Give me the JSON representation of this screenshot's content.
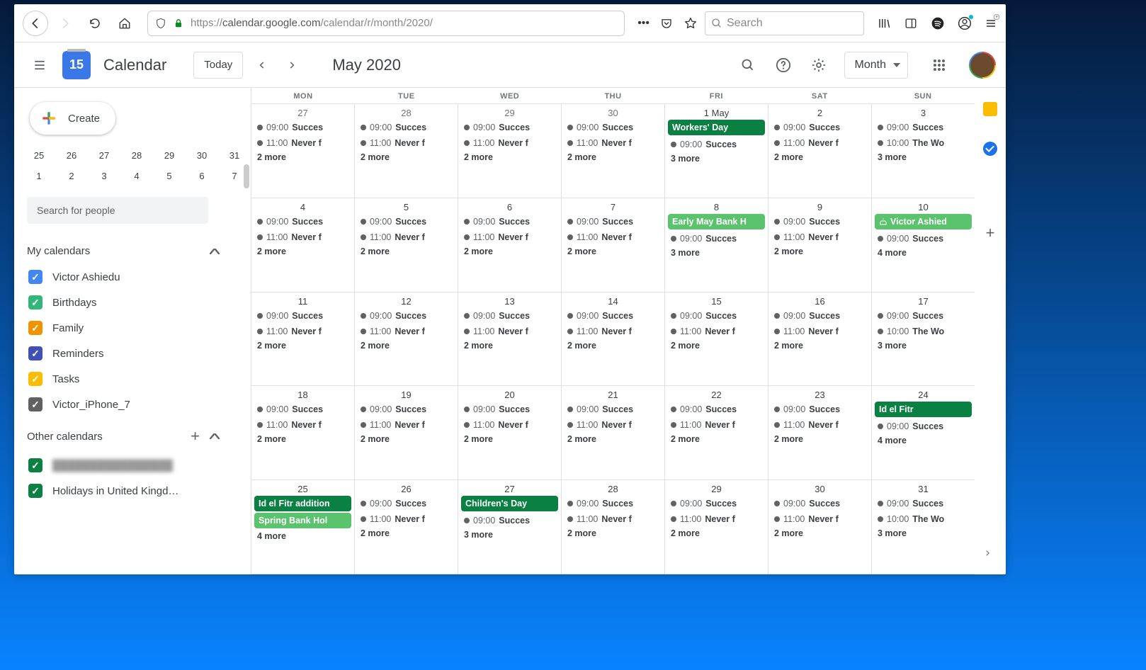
{
  "chrome": {
    "url_prefix": "https://",
    "url_host": "calendar.google.com",
    "url_path": "/calendar/r/month/2020/",
    "search_placeholder": "Search"
  },
  "header": {
    "logo_num": "15",
    "title": "Calendar",
    "today_label": "Today",
    "month_title": "May 2020",
    "view_label": "Month"
  },
  "sidebar": {
    "create_label": "Create",
    "mini_row1": [
      "25",
      "26",
      "27",
      "28",
      "29",
      "30",
      "31"
    ],
    "mini_row2": [
      "1",
      "2",
      "3",
      "4",
      "5",
      "6",
      "7"
    ],
    "search_placeholder": "Search for people",
    "section1_title": "My calendars",
    "calendars": [
      {
        "label": "Victor Ashiedu",
        "color": "#4285f4"
      },
      {
        "label": "Birthdays",
        "color": "#33b679"
      },
      {
        "label": "Family",
        "color": "#f09300"
      },
      {
        "label": "Reminders",
        "color": "#3f51b5"
      },
      {
        "label": "Tasks",
        "color": "#fbbc04"
      },
      {
        "label": "Victor_iPhone_7",
        "color": "#616161"
      }
    ],
    "section2_title": "Other calendars",
    "other_calendars": [
      {
        "label": "████████████████",
        "color": "#0b8043",
        "blur": true
      },
      {
        "label": "Holidays in United Kingd…",
        "color": "#0b8043"
      }
    ]
  },
  "dow": [
    "MON",
    "TUE",
    "WED",
    "THU",
    "FRI",
    "SAT",
    "SUN"
  ],
  "weeks": [
    {
      "days": [
        {
          "num": "27",
          "cur": false,
          "alldays": [],
          "events": [
            [
              "09:00",
              "Succes"
            ],
            [
              "11:00",
              "Never f"
            ]
          ],
          "more": "2 more"
        },
        {
          "num": "28",
          "cur": false,
          "alldays": [],
          "events": [
            [
              "09:00",
              "Succes"
            ],
            [
              "11:00",
              "Never f"
            ]
          ],
          "more": "2 more"
        },
        {
          "num": "29",
          "cur": false,
          "alldays": [],
          "events": [
            [
              "09:00",
              "Succes"
            ],
            [
              "11:00",
              "Never f"
            ]
          ],
          "more": "2 more"
        },
        {
          "num": "30",
          "cur": false,
          "alldays": [],
          "events": [
            [
              "09:00",
              "Succes"
            ],
            [
              "11:00",
              "Never f"
            ]
          ],
          "more": "2 more"
        },
        {
          "num": "1 May",
          "cur": true,
          "alldays": [
            {
              "text": "Workers' Day",
              "style": "dark"
            }
          ],
          "events": [
            [
              "09:00",
              "Succes"
            ]
          ],
          "more": "3 more"
        },
        {
          "num": "2",
          "cur": true,
          "alldays": [],
          "events": [
            [
              "09:00",
              "Succes"
            ],
            [
              "11:00",
              "Never f"
            ]
          ],
          "more": "2 more"
        },
        {
          "num": "3",
          "cur": true,
          "alldays": [],
          "events": [
            [
              "09:00",
              "Succes"
            ],
            [
              "10:00",
              "The Wo"
            ]
          ],
          "more": "3 more"
        }
      ]
    },
    {
      "days": [
        {
          "num": "4",
          "cur": true,
          "alldays": [],
          "events": [
            [
              "09:00",
              "Succes"
            ],
            [
              "11:00",
              "Never f"
            ]
          ],
          "more": "2 more"
        },
        {
          "num": "5",
          "cur": true,
          "alldays": [],
          "events": [
            [
              "09:00",
              "Succes"
            ],
            [
              "11:00",
              "Never f"
            ]
          ],
          "more": "2 more"
        },
        {
          "num": "6",
          "cur": true,
          "alldays": [],
          "events": [
            [
              "09:00",
              "Succes"
            ],
            [
              "11:00",
              "Never f"
            ]
          ],
          "more": "2 more"
        },
        {
          "num": "7",
          "cur": true,
          "alldays": [],
          "events": [
            [
              "09:00",
              "Succes"
            ],
            [
              "11:00",
              "Never f"
            ]
          ],
          "more": "2 more"
        },
        {
          "num": "8",
          "cur": true,
          "alldays": [
            {
              "text": "Early May Bank H",
              "style": "light"
            }
          ],
          "events": [
            [
              "09:00",
              "Succes"
            ]
          ],
          "more": "3 more"
        },
        {
          "num": "9",
          "cur": true,
          "alldays": [],
          "events": [
            [
              "09:00",
              "Succes"
            ],
            [
              "11:00",
              "Never f"
            ]
          ],
          "more": "2 more"
        },
        {
          "num": "10",
          "cur": true,
          "alldays": [
            {
              "text": "Victor Ashied",
              "style": "light",
              "icon": "birthday"
            }
          ],
          "events": [
            [
              "09:00",
              "Succes"
            ]
          ],
          "more": "4 more",
          "highlight": true
        }
      ]
    },
    {
      "days": [
        {
          "num": "11",
          "cur": true,
          "alldays": [],
          "events": [
            [
              "09:00",
              "Succes"
            ],
            [
              "11:00",
              "Never f"
            ]
          ],
          "more": "2 more"
        },
        {
          "num": "12",
          "cur": true,
          "alldays": [],
          "events": [
            [
              "09:00",
              "Succes"
            ],
            [
              "11:00",
              "Never f"
            ]
          ],
          "more": "2 more"
        },
        {
          "num": "13",
          "cur": true,
          "alldays": [],
          "events": [
            [
              "09:00",
              "Succes"
            ],
            [
              "11:00",
              "Never f"
            ]
          ],
          "more": "2 more"
        },
        {
          "num": "14",
          "cur": true,
          "alldays": [],
          "events": [
            [
              "09:00",
              "Succes"
            ],
            [
              "11:00",
              "Never f"
            ]
          ],
          "more": "2 more"
        },
        {
          "num": "15",
          "cur": true,
          "alldays": [],
          "events": [
            [
              "09:00",
              "Succes"
            ],
            [
              "11:00",
              "Never f"
            ]
          ],
          "more": "2 more"
        },
        {
          "num": "16",
          "cur": true,
          "alldays": [],
          "events": [
            [
              "09:00",
              "Succes"
            ],
            [
              "11:00",
              "Never f"
            ]
          ],
          "more": "2 more"
        },
        {
          "num": "17",
          "cur": true,
          "alldays": [],
          "events": [
            [
              "09:00",
              "Succes"
            ],
            [
              "10:00",
              "The Wo"
            ]
          ],
          "more": "3 more"
        }
      ]
    },
    {
      "days": [
        {
          "num": "18",
          "cur": true,
          "alldays": [],
          "events": [
            [
              "09:00",
              "Succes"
            ],
            [
              "11:00",
              "Never f"
            ]
          ],
          "more": "2 more"
        },
        {
          "num": "19",
          "cur": true,
          "alldays": [],
          "events": [
            [
              "09:00",
              "Succes"
            ],
            [
              "11:00",
              "Never f"
            ]
          ],
          "more": "2 more"
        },
        {
          "num": "20",
          "cur": true,
          "alldays": [],
          "events": [
            [
              "09:00",
              "Succes"
            ],
            [
              "11:00",
              "Never f"
            ]
          ],
          "more": "2 more"
        },
        {
          "num": "21",
          "cur": true,
          "alldays": [],
          "events": [
            [
              "09:00",
              "Succes"
            ],
            [
              "11:00",
              "Never f"
            ]
          ],
          "more": "2 more"
        },
        {
          "num": "22",
          "cur": true,
          "alldays": [],
          "events": [
            [
              "09:00",
              "Succes"
            ],
            [
              "11:00",
              "Never f"
            ]
          ],
          "more": "2 more"
        },
        {
          "num": "23",
          "cur": true,
          "alldays": [],
          "events": [
            [
              "09:00",
              "Succes"
            ],
            [
              "11:00",
              "Never f"
            ]
          ],
          "more": "2 more"
        },
        {
          "num": "24",
          "cur": true,
          "alldays": [
            {
              "text": "Id el Fitr",
              "style": "dark"
            }
          ],
          "events": [
            [
              "09:00",
              "Succes"
            ]
          ],
          "more": "4 more"
        }
      ]
    },
    {
      "days": [
        {
          "num": "25",
          "cur": true,
          "alldays": [
            {
              "text": "Id el Fitr addition",
              "style": "dark"
            },
            {
              "text": "Spring Bank Hol",
              "style": "light"
            }
          ],
          "events": [],
          "more": "4 more"
        },
        {
          "num": "26",
          "cur": true,
          "alldays": [],
          "events": [
            [
              "09:00",
              "Succes"
            ],
            [
              "11:00",
              "Never f"
            ]
          ],
          "more": "2 more"
        },
        {
          "num": "27",
          "cur": true,
          "alldays": [
            {
              "text": "Children's Day",
              "style": "dark"
            }
          ],
          "events": [
            [
              "09:00",
              "Succes"
            ]
          ],
          "more": "3 more"
        },
        {
          "num": "28",
          "cur": true,
          "alldays": [],
          "events": [
            [
              "09:00",
              "Succes"
            ],
            [
              "11:00",
              "Never f"
            ]
          ],
          "more": "2 more"
        },
        {
          "num": "29",
          "cur": true,
          "alldays": [],
          "events": [
            [
              "09:00",
              "Succes"
            ],
            [
              "11:00",
              "Never f"
            ]
          ],
          "more": "2 more"
        },
        {
          "num": "30",
          "cur": true,
          "alldays": [],
          "events": [
            [
              "09:00",
              "Succes"
            ],
            [
              "11:00",
              "Never f"
            ]
          ],
          "more": "2 more"
        },
        {
          "num": "31",
          "cur": true,
          "alldays": [],
          "events": [
            [
              "09:00",
              "Succes"
            ],
            [
              "10:00",
              "The Wo"
            ]
          ],
          "more": "3 more"
        }
      ]
    }
  ]
}
